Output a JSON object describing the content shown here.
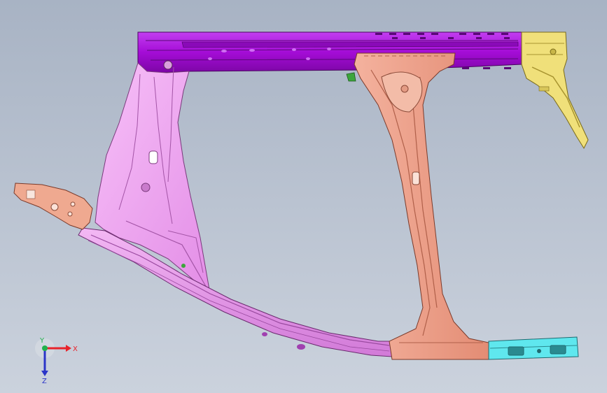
{
  "viewport": {
    "background_top": "#a8b3c4",
    "background_bottom": "#cbd2dd"
  },
  "model": {
    "parts": [
      {
        "name": "roof-rail",
        "color": "#a40cd6"
      },
      {
        "name": "a-pillar-inner",
        "color": "#f0a0f2"
      },
      {
        "name": "b-pillar",
        "color": "#ef9f88"
      },
      {
        "name": "c-pillar-extension",
        "color": "#f0e07a"
      },
      {
        "name": "front-bracket",
        "color": "#efa990"
      },
      {
        "name": "sill-extension",
        "color": "#5fe7ee"
      },
      {
        "name": "small-bracket",
        "color": "#3ca53c"
      }
    ]
  },
  "triad": {
    "x_label": "X",
    "y_label": "Y",
    "z_label": "Z",
    "x_color": "#e8232b",
    "y_color": "#22b14c",
    "z_color": "#2b35c8"
  }
}
